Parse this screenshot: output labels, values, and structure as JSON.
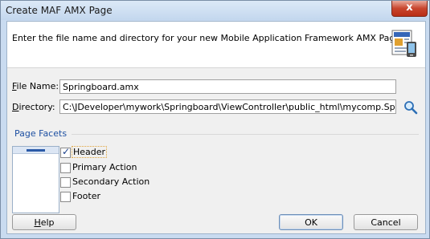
{
  "window": {
    "title": "Create MAF AMX Page",
    "close_label": "x"
  },
  "header": {
    "description": "Enter the file name and directory for your new Mobile Application Framework AMX Page.",
    "icon": "wizard-page-icon"
  },
  "form": {
    "file_name_label_mnemonic": "F",
    "file_name_label_rest": "ile Name:",
    "file_name_value": "Springboard.amx",
    "directory_label_mnemonic": "D",
    "directory_label_rest": "irectory:",
    "directory_value": "C:\\JDeveloper\\mywork\\Springboard\\ViewController\\public_html\\mycomp.Springboard",
    "browse_icon": "search-icon"
  },
  "facets": {
    "section_title": "Page Facets",
    "items": [
      {
        "label": "Header",
        "checked": true
      },
      {
        "label": "Primary Action",
        "checked": false
      },
      {
        "label": "Secondary Action",
        "checked": false
      },
      {
        "label": "Footer",
        "checked": false
      }
    ]
  },
  "buttons": {
    "help_mnemonic": "H",
    "help_rest": "elp",
    "ok": "OK",
    "cancel": "Cancel"
  },
  "colors": {
    "section_title": "#1e50a2",
    "close_button": "#c8452d"
  }
}
